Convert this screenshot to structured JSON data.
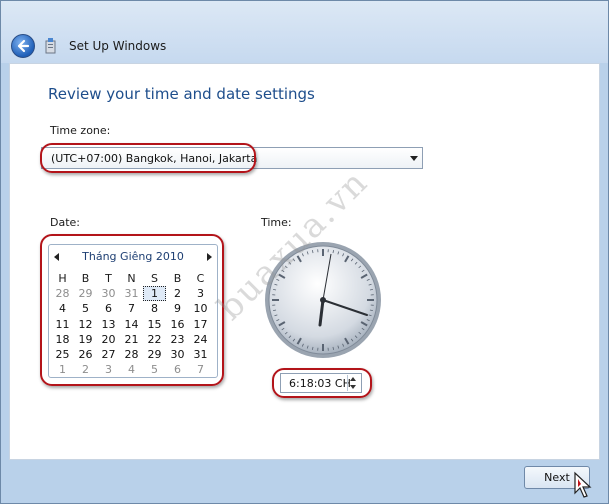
{
  "window": {
    "title": "Set Up Windows"
  },
  "page": {
    "heading": "Review your time and date settings"
  },
  "timezone": {
    "label": "Time zone:",
    "value": "(UTC+07:00) Bangkok, Hanoi, Jakarta"
  },
  "date": {
    "label": "Date:",
    "month_title": "Tháng Giêng 2010",
    "days_of_week": [
      "H",
      "B",
      "T",
      "N",
      "S",
      "B",
      "C"
    ],
    "weeks": [
      [
        {
          "d": "28",
          "o": true
        },
        {
          "d": "29",
          "o": true
        },
        {
          "d": "30",
          "o": true
        },
        {
          "d": "31",
          "o": true
        },
        {
          "d": "1",
          "sel": true
        },
        {
          "d": "2"
        },
        {
          "d": "3"
        }
      ],
      [
        {
          "d": "4"
        },
        {
          "d": "5"
        },
        {
          "d": "6"
        },
        {
          "d": "7"
        },
        {
          "d": "8"
        },
        {
          "d": "9"
        },
        {
          "d": "10"
        }
      ],
      [
        {
          "d": "11"
        },
        {
          "d": "12"
        },
        {
          "d": "13"
        },
        {
          "d": "14"
        },
        {
          "d": "15"
        },
        {
          "d": "16"
        },
        {
          "d": "17"
        }
      ],
      [
        {
          "d": "18"
        },
        {
          "d": "19"
        },
        {
          "d": "20"
        },
        {
          "d": "21"
        },
        {
          "d": "22"
        },
        {
          "d": "23"
        },
        {
          "d": "24"
        }
      ],
      [
        {
          "d": "25"
        },
        {
          "d": "26"
        },
        {
          "d": "27"
        },
        {
          "d": "28"
        },
        {
          "d": "29"
        },
        {
          "d": "30"
        },
        {
          "d": "31"
        }
      ],
      [
        {
          "d": "1",
          "o": true
        },
        {
          "d": "2",
          "o": true
        },
        {
          "d": "3",
          "o": true
        },
        {
          "d": "4",
          "o": true
        },
        {
          "d": "5",
          "o": true
        },
        {
          "d": "6",
          "o": true
        },
        {
          "d": "7",
          "o": true
        }
      ]
    ]
  },
  "time": {
    "label": "Time:",
    "value": "6:18:03 CH"
  },
  "watermark": "buaxua.vn",
  "buttons": {
    "next": "Next"
  },
  "colors": {
    "highlight": "#b3141a",
    "heading": "#1e4e8c",
    "accent": "#1f5fb8"
  }
}
